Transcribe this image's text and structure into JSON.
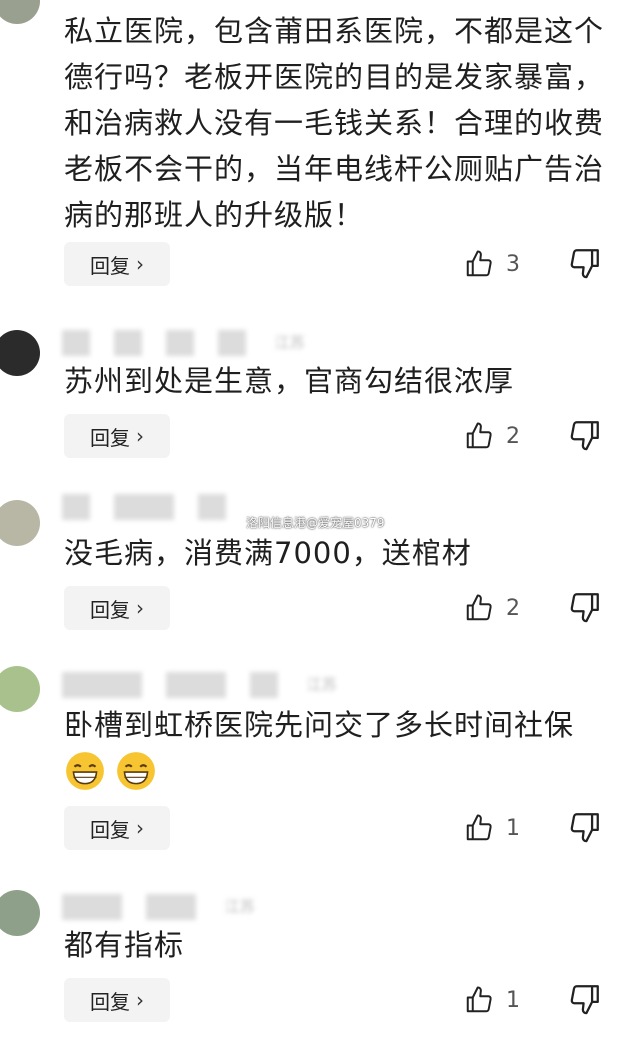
{
  "comments": [
    {
      "text": "私立医院，包含莆田系医院，不都是这个德行吗？老板开医院的目的是发家暴富，和治病救人没有一毛钱关系！合理的收费老板不会干的，当年电线杆公厕贴广告治病的那班人的升级版！",
      "reply_label": "回复",
      "likes": "3"
    },
    {
      "meta": "江苏",
      "text": "苏州到处是生意，官商勾结很浓厚",
      "reply_label": "回复",
      "likes": "2"
    },
    {
      "text": "没毛病，消费满7000，送棺材",
      "reply_label": "回复",
      "likes": "2"
    },
    {
      "meta": "江苏",
      "text": "卧槽到虹桥医院先问交了多长时间社保",
      "reply_label": "回复",
      "likes": "1"
    },
    {
      "meta": "江苏",
      "text": "都有指标",
      "reply_label": "回复",
      "likes": "1"
    }
  ],
  "watermark": "洛阳信息港@爱宠屋0379",
  "icons": {
    "like": "thumbs-up-icon",
    "dislike": "thumbs-down-icon",
    "reply_arrow": "chevron-right-icon",
    "emoji": "grinning-face-emoji"
  }
}
